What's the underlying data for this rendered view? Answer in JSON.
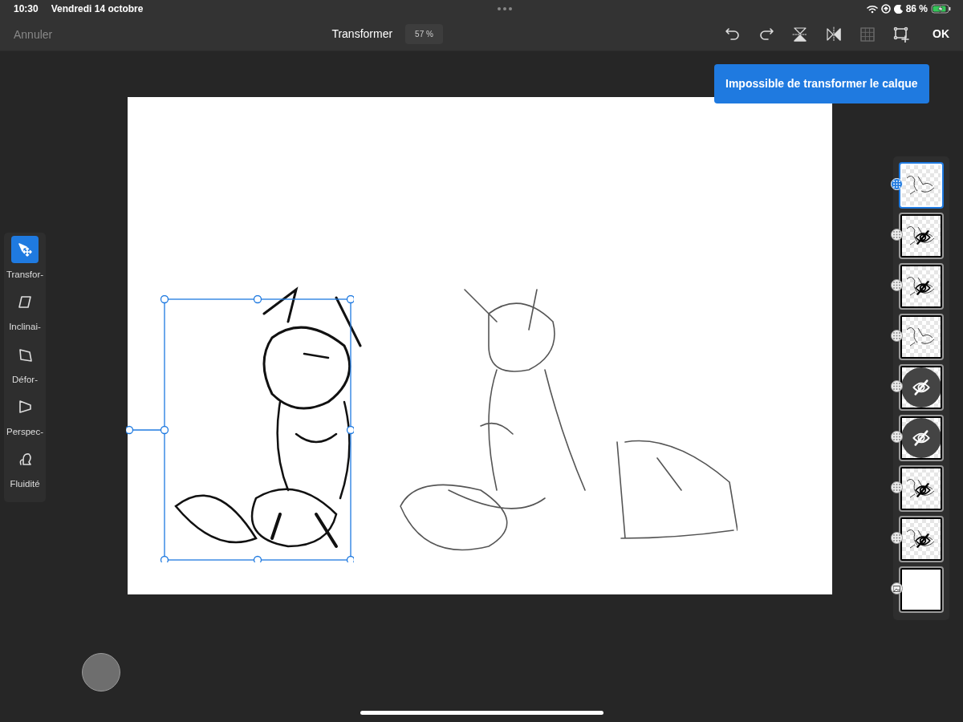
{
  "status_bar": {
    "time": "10:30",
    "date": "Vendredi 14 octobre",
    "battery": "86 %"
  },
  "toolbar": {
    "cancel": "Annuler",
    "title": "Transformer",
    "zoom": "57 %",
    "confirm": "OK",
    "icons": [
      {
        "kind": "undo",
        "disabled": false
      },
      {
        "kind": "redo",
        "disabled": false
      },
      {
        "kind": "flip-vertical",
        "disabled": false
      },
      {
        "kind": "flip-horizontal",
        "disabled": false
      },
      {
        "kind": "grid",
        "disabled": true
      },
      {
        "kind": "transform-box",
        "disabled": false
      }
    ]
  },
  "toast": "Impossible de transformer le calque",
  "tools": [
    {
      "kind": "transform",
      "label": "Transfor-",
      "selected": true
    },
    {
      "kind": "skew",
      "label": "Inclinai-",
      "selected": false
    },
    {
      "kind": "distort",
      "label": "Défor-",
      "selected": false
    },
    {
      "kind": "perspective",
      "label": "Perspec-",
      "selected": false
    },
    {
      "kind": "liquify",
      "label": "Fluidité",
      "selected": false
    }
  ],
  "layers": [
    {
      "kind": "pixel",
      "selected": true,
      "hidden": false
    },
    {
      "kind": "pixel",
      "selected": false,
      "hidden": true
    },
    {
      "kind": "pixel",
      "selected": false,
      "hidden": true
    },
    {
      "kind": "pixel",
      "selected": false,
      "hidden": false
    },
    {
      "kind": "empty",
      "selected": false,
      "hidden": true
    },
    {
      "kind": "empty",
      "selected": false,
      "hidden": true
    },
    {
      "kind": "pixel",
      "selected": false,
      "hidden": true
    },
    {
      "kind": "pixel",
      "selected": false,
      "hidden": true
    },
    {
      "kind": "background",
      "selected": false,
      "hidden": false
    }
  ]
}
